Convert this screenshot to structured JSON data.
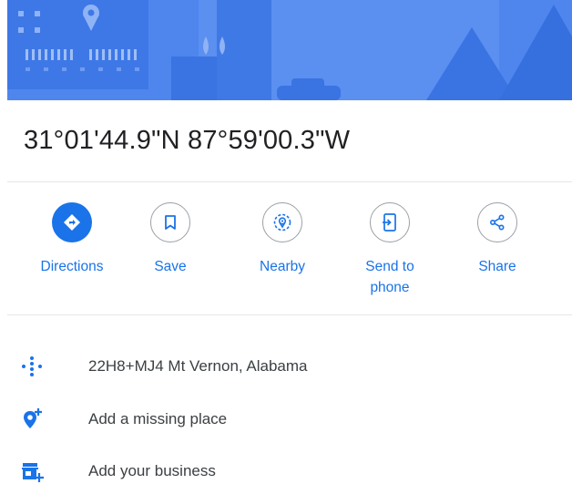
{
  "place": {
    "coordinates": "31°01'44.9\"N 87°59'00.3\"W"
  },
  "actions": [
    {
      "name": "directions",
      "label": "Directions",
      "icon": "directions-icon"
    },
    {
      "name": "save",
      "label": "Save",
      "icon": "bookmark-icon"
    },
    {
      "name": "nearby",
      "label": "Nearby",
      "icon": "nearby-icon"
    },
    {
      "name": "send-to-phone",
      "label": "Send to phone",
      "icon": "send-to-phone-icon"
    },
    {
      "name": "share",
      "label": "Share",
      "icon": "share-icon"
    }
  ],
  "info_rows": [
    {
      "label": "22H8+MJ4 Mt Vernon, Alabama",
      "icon": "plus-code-icon"
    },
    {
      "label": "Add a missing place",
      "icon": "add-place-pin-icon"
    },
    {
      "label": "Add your business",
      "icon": "add-business-icon"
    }
  ],
  "colors": {
    "accent": "#1a73e8",
    "hero_background": "#4f86ee",
    "text": "#202124",
    "secondary_text": "#3c4043",
    "divider": "#e6e6e6"
  }
}
